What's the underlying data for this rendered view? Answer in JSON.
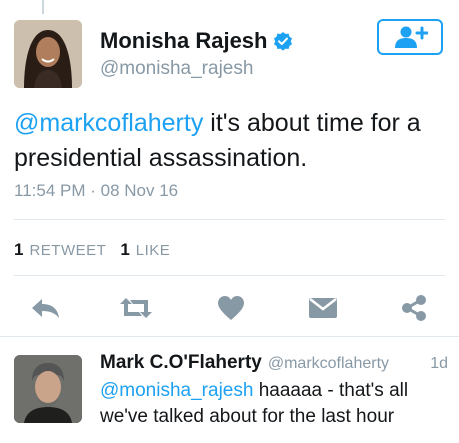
{
  "tweet": {
    "display_name": "Monisha Rajesh",
    "handle": "@monisha_rajesh",
    "verified": true,
    "text_mention": "@markcoflaherty",
    "text_body": " it's about time for a presidential assassination.",
    "timestamp": "11:54 PM · 08 Nov 16",
    "retweet_count": "1",
    "retweet_label": "RETWEET",
    "like_count": "1",
    "like_label": "LIKE"
  },
  "actions": {
    "icons": [
      "reply-icon",
      "retweet-icon",
      "heart-icon",
      "envelope-icon",
      "share-icon"
    ],
    "color": "#8899a6"
  },
  "follow_button": {
    "icon": "add-user-icon",
    "color": "#1da1f2"
  },
  "reply": {
    "display_name": "Mark C.O'Flaherty",
    "handle": "@markcoflaherty",
    "time": "1d",
    "text_mention": "@monisha_rajesh",
    "text_body": " haaaaa - that's all we've talked about for the last hour"
  },
  "colors": {
    "accent": "#1da1f2",
    "muted": "#8899a6",
    "text": "#14171a",
    "divider": "#e1e8ed"
  }
}
